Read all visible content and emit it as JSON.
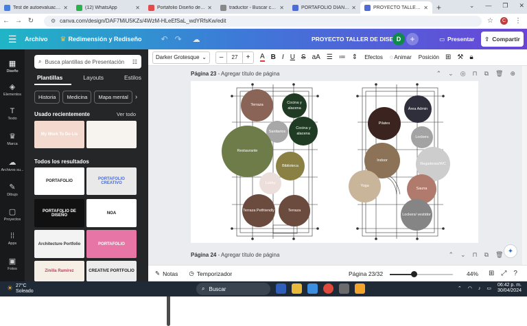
{
  "browser": {
    "tabs": [
      {
        "label": "Test de autoevaluación en",
        "color": "#4a7de0",
        "active": false
      },
      {
        "label": "(12) WhatsApp",
        "color": "#29b44b",
        "active": false
      },
      {
        "label": "Portafolio Diseño de Interi",
        "color": "#e44b4b",
        "active": false
      },
      {
        "label": "traductor - Buscar con Go",
        "color": "#888888",
        "active": false
      },
      {
        "label": "PORTAFOLIO DIANA CÓRD",
        "color": "#4e6bd6",
        "active": false
      },
      {
        "label": "PROYECTO TALLER DE DIS",
        "color": "#4e6bd6",
        "active": true
      }
    ],
    "new_tab": "+",
    "url": "canva.com/design/DAF7MiU5KZs/4WzM-HLeEfSaL_wdYRfsKw/edit",
    "profile_letter": "C"
  },
  "topbar": {
    "archivo": "Archivo",
    "resize": "Redimensión y Rediseño",
    "project_title": "PROYECTO TALLER DE DISEÑO",
    "user_initial": "D",
    "present": "Presentar",
    "share": "Compartir"
  },
  "rail": [
    {
      "label": "Diseño",
      "glyph": "▦"
    },
    {
      "label": "Elementos",
      "glyph": "◈"
    },
    {
      "label": "Texto",
      "glyph": "T"
    },
    {
      "label": "Marca",
      "glyph": "♛"
    },
    {
      "label": "Archivos su...",
      "glyph": "☁"
    },
    {
      "label": "Dibujo",
      "glyph": "✎"
    },
    {
      "label": "Proyectos",
      "glyph": "▢"
    },
    {
      "label": "Apps",
      "glyph": "⁞⁞"
    },
    {
      "label": "Fotos",
      "glyph": "▣"
    }
  ],
  "panel": {
    "search_placeholder": "Busca plantillas de Presentación",
    "tabs": [
      "Plantillas",
      "Layouts",
      "Estilos"
    ],
    "chips": [
      "Historia",
      "Medicina",
      "Mapa mental"
    ],
    "recent_heading": "Usado recientemente",
    "see_all": "Ver todo",
    "results_heading": "Todos los resultados",
    "thumbs": [
      {
        "text": "My Work To Do Lis",
        "bg": "#f4d9cf",
        "fg": "#ffffff"
      },
      {
        "text": "",
        "bg": "#f7f3ef",
        "fg": "#333333"
      },
      {
        "text": "PORTAFOLIO",
        "bg": "#ffffff",
        "fg": "#222222"
      },
      {
        "text": "PORTAFOLIO CREATIVO",
        "bg": "#e9e9e9",
        "fg": "#4a6bd0"
      },
      {
        "text": "PORTAFOLIO DE DISEÑO",
        "bg": "#111111",
        "fg": "#ffffff"
      },
      {
        "text": "NOA",
        "bg": "#ffffff",
        "fg": "#111111"
      },
      {
        "text": "Architecture Portfolio",
        "bg": "#f3f3f3",
        "fg": "#333333"
      },
      {
        "text": "PORTAFOLIO",
        "bg": "#e776a6",
        "fg": "#ffffff"
      },
      {
        "text": "Zinilla Ramírez",
        "bg": "#f5efe6",
        "fg": "#c03e66"
      },
      {
        "text": "CREATIVE PORTFOLIO",
        "bg": "#ececec",
        "fg": "#222222"
      }
    ]
  },
  "toolbar": {
    "font": "Darker Grotesque",
    "size": "27",
    "minus": "–",
    "plus": "+",
    "effects": "Efectos",
    "animate": "Animar",
    "position": "Posición"
  },
  "pages": {
    "current_label": "Página 23",
    "current_title": "Agregar título de página",
    "next_label": "Página 24",
    "next_title": "Agregar título de página"
  },
  "plan": {
    "bubbles": [
      {
        "label": "Terraza",
        "bg": "#8a6557",
        "fg": "#ffffff"
      },
      {
        "label": "Cocina y alacena",
        "bg": "#1f3b23",
        "fg": "#ffffff"
      },
      {
        "label": "Sanitarios",
        "bg": "#a8a8a8",
        "fg": "#ffffff"
      },
      {
        "label": "Cocina y alacena",
        "bg": "#1f3b23",
        "fg": "#ffffff"
      },
      {
        "label": "Restaurante",
        "bg": "#6d7c48",
        "fg": "#ffffff"
      },
      {
        "label": "Biblioteca",
        "bg": "#8a8044",
        "fg": "#ffffff"
      },
      {
        "label": "Lobby",
        "bg": "#ecdfdb",
        "fg": "#ffffff"
      },
      {
        "label": "Terraza Petfriendly",
        "bg": "#6b4b3e",
        "fg": "#ffffff"
      },
      {
        "label": "Terraza",
        "bg": "#6b4b3e",
        "fg": "#ffffff"
      },
      {
        "label": "Área Admin",
        "bg": "#2f2f3c",
        "fg": "#ffffff"
      },
      {
        "label": "Pilates",
        "bg": "#3b2420",
        "fg": "#ffffff"
      },
      {
        "label": "Lockers",
        "bg": "#a3a3a3",
        "fg": "#ffffff"
      },
      {
        "label": "Indoor",
        "bg": "#8c7357",
        "fg": "#ffffff"
      },
      {
        "label": "Regaderas/WC",
        "bg": "#cdcdcd",
        "fg": "#ffffff"
      },
      {
        "label": "Yoga",
        "bg": "#c8b59a",
        "fg": "#ffffff"
      },
      {
        "label": "Sauna",
        "bg": "#b07a6c",
        "fg": "#ffffff"
      },
      {
        "label": "Lockers/ vestidor",
        "bg": "#858585",
        "fg": "#ffffff"
      }
    ]
  },
  "bottombar": {
    "notes": "Notas",
    "timer": "Temporizador",
    "page_count": "Página 23/32",
    "zoom": "44%",
    "zoom_fraction": 0.38
  },
  "taskbar": {
    "temp": "27°C",
    "weather": "Soleado",
    "search": "Buscar",
    "time": "06:42 p. m.",
    "date": "30/04/2024"
  }
}
